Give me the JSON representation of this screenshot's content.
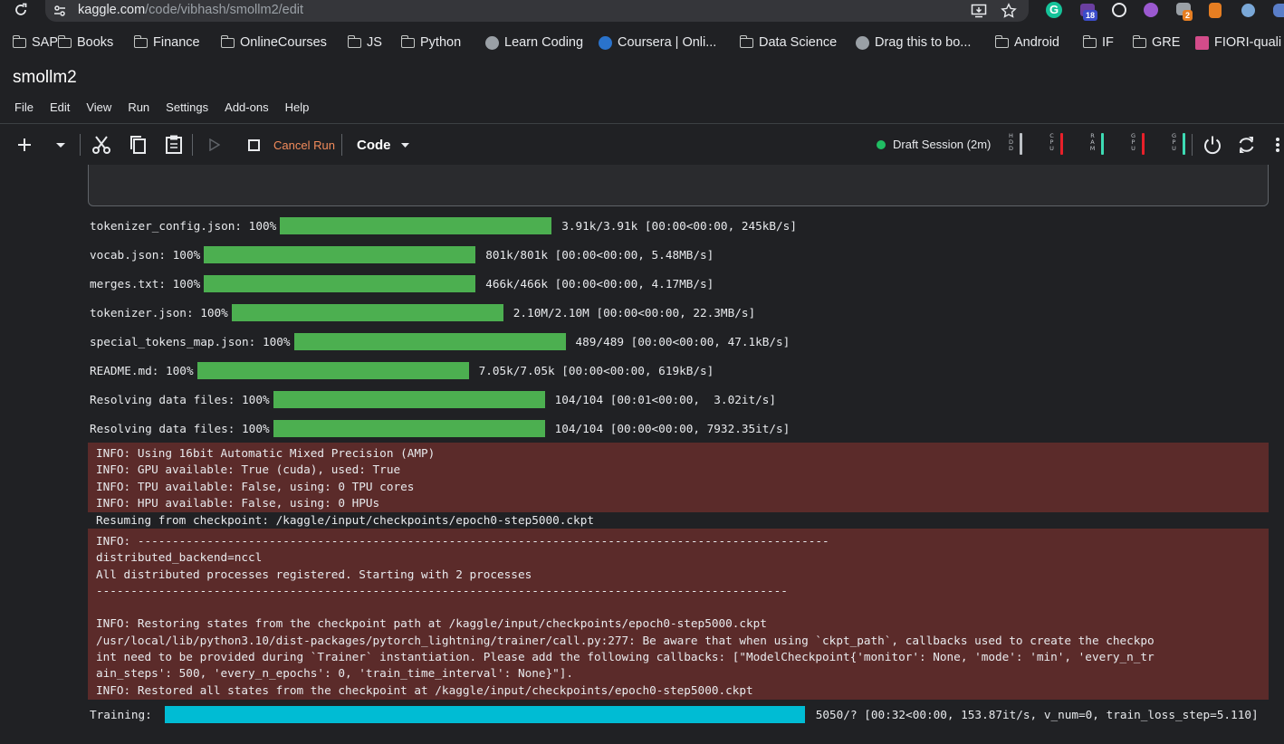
{
  "browser": {
    "url_host": "kaggle.com",
    "url_path": "/code/vibhash/smollm2/edit",
    "bookmarks": [
      {
        "label": "SAP",
        "icon": "folder-icon"
      },
      {
        "label": "Books",
        "icon": "folder-icon"
      },
      {
        "label": "Finance",
        "icon": "folder-icon"
      },
      {
        "label": "OnlineCourses",
        "icon": "folder-icon"
      },
      {
        "label": "JS",
        "icon": "folder-icon"
      },
      {
        "label": "Python",
        "icon": "folder-icon"
      },
      {
        "label": "Learn Coding",
        "icon": "github-icon"
      },
      {
        "label": "Coursera | Onli...",
        "icon": "coursera-icon"
      },
      {
        "label": "Data Science",
        "icon": "folder-icon"
      },
      {
        "label": "Drag this to bo...",
        "icon": "globe-icon"
      },
      {
        "label": "Android",
        "icon": "folder-icon"
      },
      {
        "label": "IF",
        "icon": "folder-icon"
      },
      {
        "label": "GRE",
        "icon": "folder-icon"
      },
      {
        "label": "FIORI-quali",
        "icon": "fiori-icon"
      }
    ],
    "extension_badges": {
      "notifications": "18",
      "tasks": "2"
    }
  },
  "notebook": {
    "title": "smollm2",
    "menu": [
      "File",
      "Edit",
      "View",
      "Run",
      "Settings",
      "Add-ons",
      "Help"
    ],
    "toolbar": {
      "cancel_run": "Cancel Run",
      "cell_type": "Code",
      "session_status": "Draft Session (2m)"
    },
    "meters": [
      {
        "label": "HDD",
        "color": "#bdc1c6"
      },
      {
        "label": "CPU",
        "color": "#e8202a"
      },
      {
        "label": "RAM",
        "color": "#3ddbb4"
      },
      {
        "label": "GPU",
        "color": "#e8202a"
      },
      {
        "label": "GPU",
        "color": "#3ddbb4"
      }
    ]
  },
  "colors": {
    "progress_green": "#4caf50",
    "training_cyan": "#00bcd4",
    "stderr_bg": "#5b2b2a",
    "cancel_orange": "#f28b5b"
  },
  "output": {
    "progress": [
      {
        "label": "tokenizer_config.json: 100%",
        "stats": "3.91k/3.91k [00:00<00:00, 245kB/s]",
        "fraction": 1.0
      },
      {
        "label": "vocab.json: 100%",
        "stats": "801k/801k [00:00<00:00, 5.48MB/s]",
        "fraction": 1.0
      },
      {
        "label": "merges.txt: 100%",
        "stats": "466k/466k [00:00<00:00, 4.17MB/s]",
        "fraction": 1.0
      },
      {
        "label": "tokenizer.json: 100%",
        "stats": "2.10M/2.10M [00:00<00:00, 22.3MB/s]",
        "fraction": 1.0
      },
      {
        "label": "special_tokens_map.json: 100%",
        "stats": "489/489 [00:00<00:00, 47.1kB/s]",
        "fraction": 1.0
      },
      {
        "label": "README.md: 100%",
        "stats": "7.05k/7.05k [00:00<00:00, 619kB/s]",
        "fraction": 1.0
      },
      {
        "label": "Resolving data files: 100%",
        "stats": "104/104 [00:01<00:00,  3.02it/s]",
        "fraction": 1.0
      },
      {
        "label": "Resolving data files: 100%",
        "stats": "104/104 [00:00<00:00, 7932.35it/s]",
        "fraction": 1.0
      }
    ],
    "stderr_block_1": [
      "INFO: Using 16bit Automatic Mixed Precision (AMP)",
      "INFO: GPU available: True (cuda), used: True",
      "INFO: TPU available: False, using: 0 TPU cores",
      "INFO: HPU available: False, using: 0 HPUs"
    ],
    "stdout_line": "Resuming from checkpoint: /kaggle/input/checkpoints/epoch0-step5000.ckpt",
    "stderr_block_2": [
      "INFO: ----------------------------------------------------------------------------------------------------",
      "distributed_backend=nccl",
      "All distributed processes registered. Starting with 2 processes",
      "----------------------------------------------------------------------------------------------------",
      "",
      "INFO: Restoring states from the checkpoint path at /kaggle/input/checkpoints/epoch0-step5000.ckpt",
      "/usr/local/lib/python3.10/dist-packages/pytorch_lightning/trainer/call.py:277: Be aware that when using `ckpt_path`, callbacks used to create the checkpo",
      "int need to be provided during `Trainer` instantiation. Please add the following callbacks: [\"ModelCheckpoint{'monitor': None, 'mode': 'min', 'every_n_tr",
      "ain_steps': 500, 'every_n_epochs': 0, 'train_time_interval': None}\"].",
      "INFO: Restored all states from the checkpoint at /kaggle/input/checkpoints/epoch0-step5000.ckpt"
    ],
    "training": {
      "label": "Training:",
      "stats": "5050/? [00:32<00:00, 153.87it/s, v_num=0, train_loss_step=5.110]"
    }
  }
}
